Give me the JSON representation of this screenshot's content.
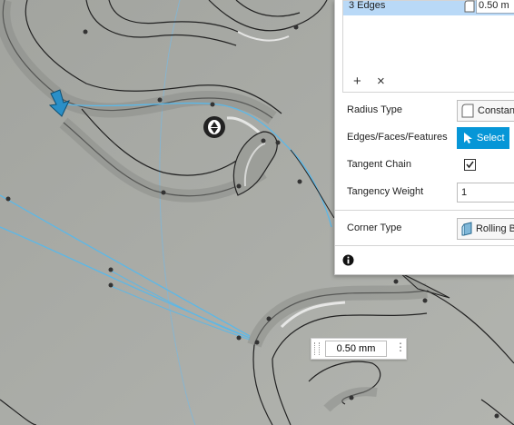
{
  "selection": {
    "label": "3 Edges",
    "value": "0.50 m"
  },
  "toolbar": {
    "add": "+",
    "remove": "×"
  },
  "properties": [
    {
      "label": "Radius Type",
      "value": "Constan"
    },
    {
      "label": "Edges/Faces/Features",
      "value": "Select"
    },
    {
      "label": "Tangent Chain",
      "checked": true
    },
    {
      "label": "Tangency Weight",
      "value": "1"
    }
  ],
  "corner": {
    "label": "Corner Type",
    "value": "Rolling B"
  },
  "info_icon": "info-icon",
  "dimension": {
    "value": "0.50 mm"
  },
  "colors": {
    "accent": "#0696d7",
    "selection": "#b9d9f7",
    "sketch": "#5bb8e8",
    "arrow": "#2a8fc7"
  }
}
